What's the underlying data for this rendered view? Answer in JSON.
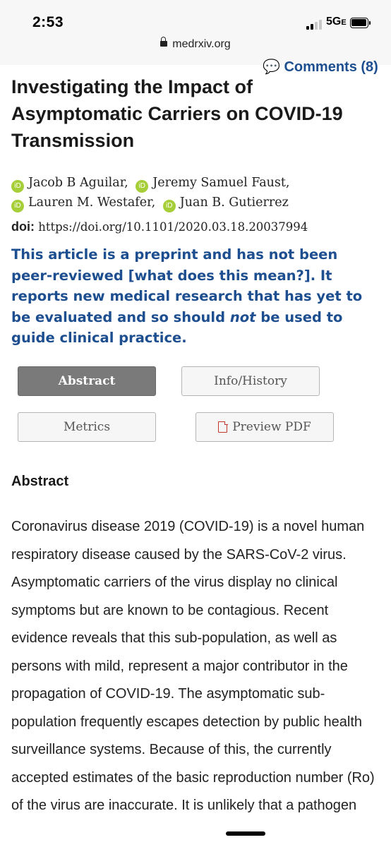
{
  "status_bar": {
    "time": "2:53",
    "network": "5G",
    "network_suffix": "E"
  },
  "browser": {
    "url": "medrxiv.org"
  },
  "comments_link": "Comments (8)",
  "title": "Investigating the Impact of Asymptomatic Carriers on COVID-19 Transmission",
  "authors": [
    "Jacob B Aguilar,",
    "Jeremy Samuel Faust,",
    "Lauren M. Westafer,",
    "Juan B. Gutierrez"
  ],
  "doi": {
    "label": "doi:",
    "value": "https://doi.org/10.1101/2020.03.18.20037994"
  },
  "notice": {
    "part1": "This article is a preprint and has not been peer-reviewed ",
    "link": "[what does this mean?]",
    "part2": ". It reports new medical research that has yet to be evaluated and so should ",
    "emphasis": "not",
    "part3": " be used to guide clinical practice."
  },
  "tabs": {
    "abstract": "Abstract",
    "info_history": "Info/History",
    "metrics": "Metrics",
    "preview_pdf": "Preview PDF"
  },
  "abstract": {
    "heading": "Abstract",
    "text": "Coronavirus disease 2019 (COVID-19) is a novel human respiratory disease caused by the SARS-CoV-2 virus. Asymptomatic carriers of the virus display no clinical symptoms but are known to be contagious. Recent evidence reveals that this sub-population, as well as persons with mild, represent a major contributor in the propagation of COVID-19. The asymptomatic sub-population frequently escapes detection by public health surveillance systems. Because of this, the currently accepted estimates of the basic reproduction number (Ro) of the virus are inaccurate. It is unlikely that a pathogen"
  },
  "colors": {
    "link_blue": "#1d4e8f",
    "orcid_green": "#a6ce39",
    "active_tab": "#7a7a7a"
  },
  "icons": [
    "lock-icon",
    "comment-icon",
    "orcid-icon",
    "pdf-icon"
  ]
}
